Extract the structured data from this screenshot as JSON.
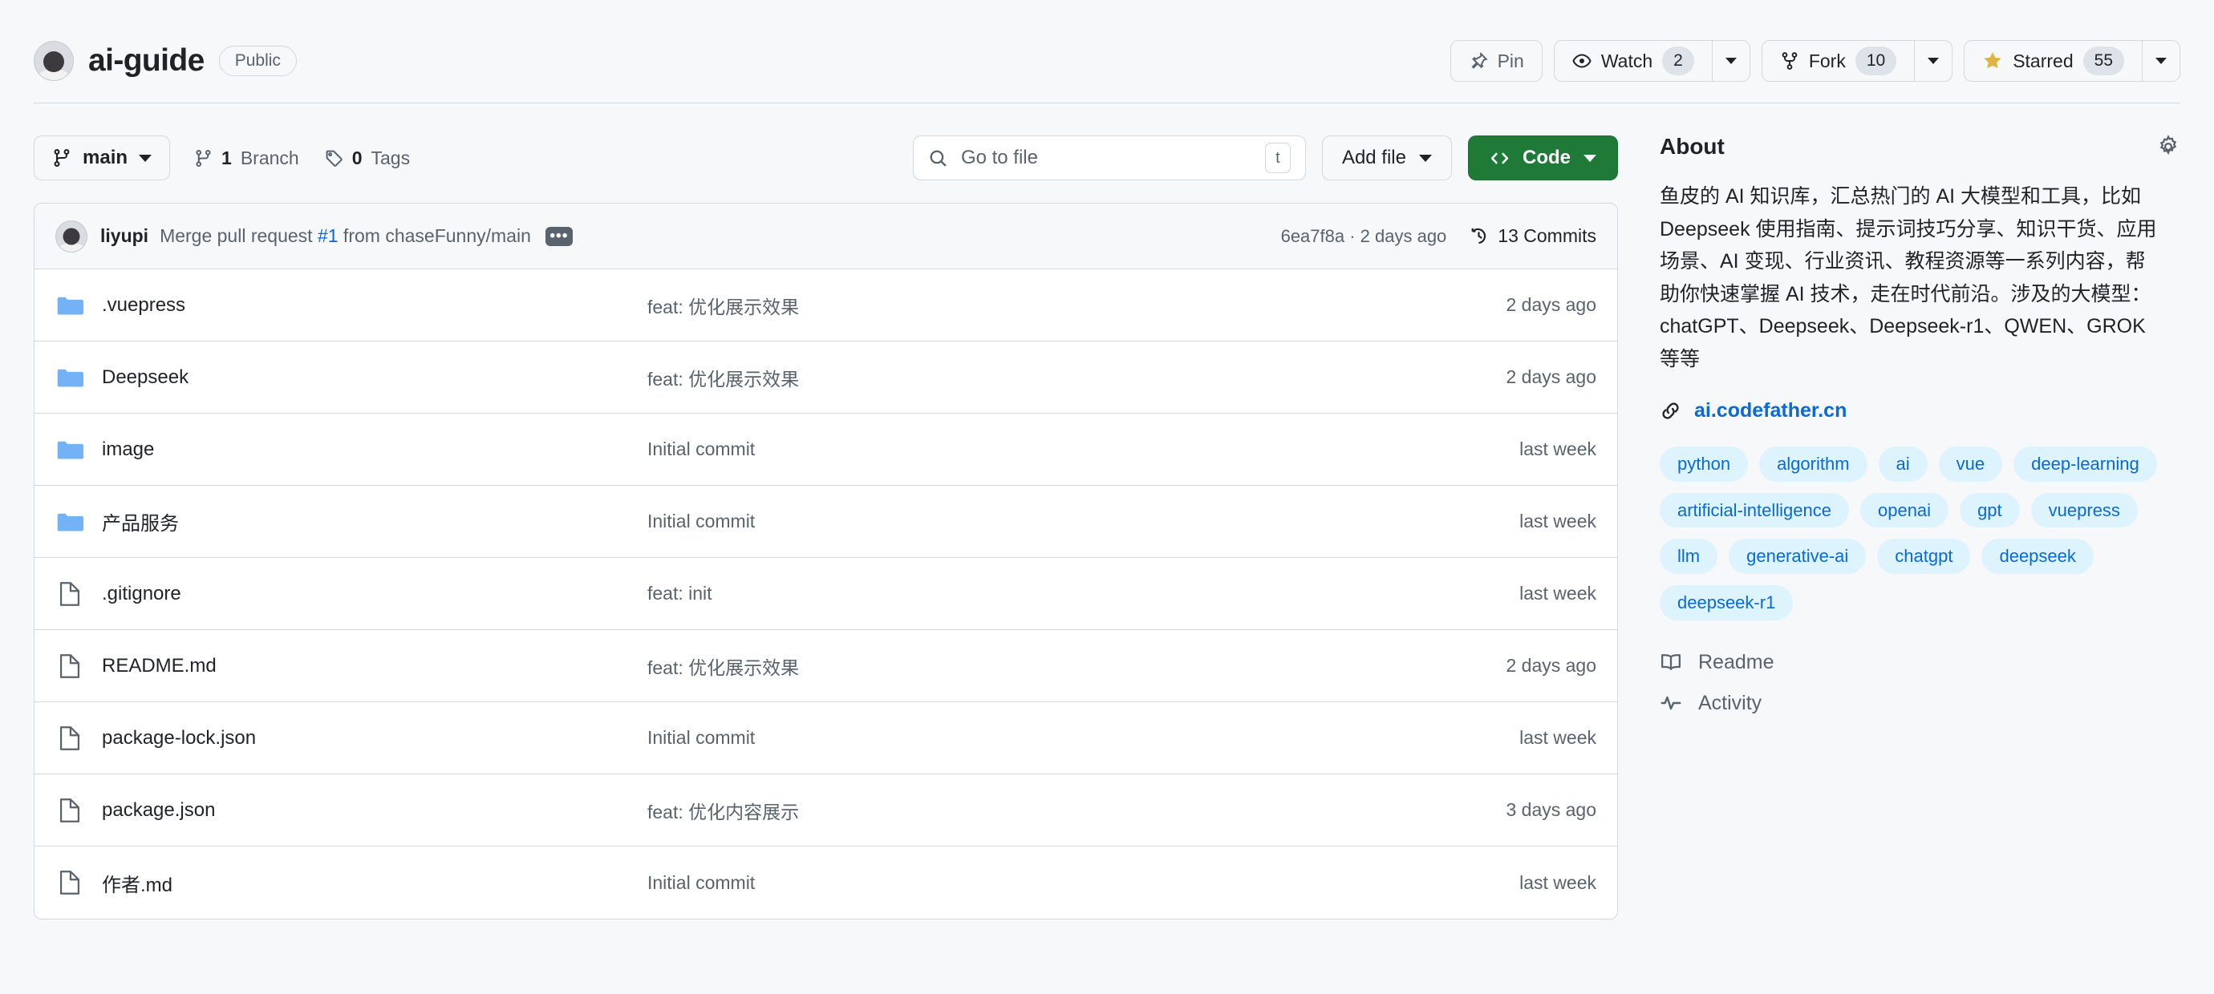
{
  "header": {
    "repo_name": "ai-guide",
    "visibility": "Public",
    "avatar_alt": "owner-avatar",
    "actions": {
      "pin_label": "Pin",
      "watch_label": "Watch",
      "watch_count": "2",
      "fork_label": "Fork",
      "fork_count": "10",
      "star_label": "Starred",
      "star_count": "55"
    }
  },
  "toolbar": {
    "branch_name": "main",
    "branch_count": "1",
    "branch_count_label": "Branch",
    "tag_count": "0",
    "tag_count_label": "Tags",
    "search_placeholder": "Go to file",
    "search_value": "",
    "search_kbd": "t",
    "add_file_label": "Add file",
    "code_label": "Code"
  },
  "commit_bar": {
    "author": "liyupi",
    "message_prefix": "Merge pull request ",
    "pr_number": "#1",
    "message_suffix": " from chaseFunny/main",
    "hash_and_time": "6ea7f8a · 2 days ago",
    "commits_count": "13 Commits"
  },
  "files": {
    "rows": [
      {
        "type": "folder",
        "name": ".vuepress",
        "commit": "feat: 优化展示效果",
        "time": "2 days ago"
      },
      {
        "type": "folder",
        "name": "Deepseek",
        "commit": "feat: 优化展示效果",
        "time": "2 days ago"
      },
      {
        "type": "folder",
        "name": "image",
        "commit": "Initial commit",
        "time": "last week"
      },
      {
        "type": "folder",
        "name": "产品服务",
        "commit": "Initial commit",
        "time": "last week"
      },
      {
        "type": "file",
        "name": ".gitignore",
        "commit": "feat: init",
        "time": "last week"
      },
      {
        "type": "file",
        "name": "README.md",
        "commit": "feat: 优化展示效果",
        "time": "2 days ago"
      },
      {
        "type": "file",
        "name": "package-lock.json",
        "commit": "Initial commit",
        "time": "last week"
      },
      {
        "type": "file",
        "name": "package.json",
        "commit": "feat: 优化内容展示",
        "time": "3 days ago"
      },
      {
        "type": "file",
        "name": "作者.md",
        "commit": "Initial commit",
        "time": "last week"
      }
    ]
  },
  "about": {
    "title": "About",
    "description": "鱼皮的 AI 知识库，汇总热门的 AI 大模型和工具，比如 Deepseek 使用指南、提示词技巧分享、知识干货、应用场景、AI 变现、行业资讯、教程资源等一系列内容，帮助你快速掌握 AI 技术，走在时代前沿。涉及的大模型：chatGPT、Deepseek、Deepseek-r1、QWEN、GROK 等等",
    "website": "ai.codefather.cn",
    "topics": [
      "python",
      "algorithm",
      "ai",
      "vue",
      "deep-learning",
      "artificial-intelligence",
      "openai",
      "gpt",
      "vuepress",
      "llm",
      "generative-ai",
      "chatgpt",
      "deepseek",
      "deepseek-r1"
    ],
    "links": [
      {
        "label": "Readme",
        "icon": "book-icon"
      },
      {
        "label": "Activity",
        "icon": "pulse-icon"
      }
    ]
  },
  "colors": {
    "accent": "#0969da",
    "green": "#1f7a37",
    "folder_blue": "#74b2f7",
    "topic_bg": "#ddf4ff",
    "muted": "#59636e",
    "border": "#d1d9e0",
    "page_bg": "#f6f8fa"
  }
}
